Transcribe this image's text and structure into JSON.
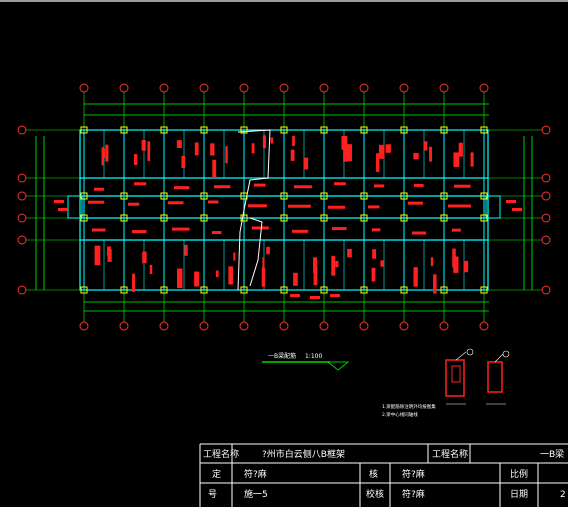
{
  "colors": {
    "background": "#000000",
    "grid": "#00ff00",
    "axis_bubble": "#ff3030",
    "beam": "#00ffff",
    "rebar_text": "#ff2020",
    "column": "#ffff00",
    "titleblock": "#ffffff"
  },
  "plan": {
    "title": "一B梁配筋",
    "scale": "1:100",
    "note_line_1": "1.梁配筋除注明外均按图集",
    "note_line_2": "2.梁中心线同轴线"
  },
  "title_block": {
    "project_name_label": "工程名称",
    "project_name_value": "?州市白云侧八B框架",
    "project_name_label_2": "工程名称",
    "drawing_name_value": "一B梁",
    "row2_label_1": "定",
    "row2_value_1": "符?麻",
    "row2_label_2": "核",
    "row2_value_2": "符?麻",
    "row2_label_3": "比例",
    "row3_label_1": "号",
    "row3_value_1": "施一5",
    "row3_label_2": "校核",
    "row3_value_2": "符?麻",
    "row3_label_3": "日期",
    "row3_value_3": "2"
  }
}
